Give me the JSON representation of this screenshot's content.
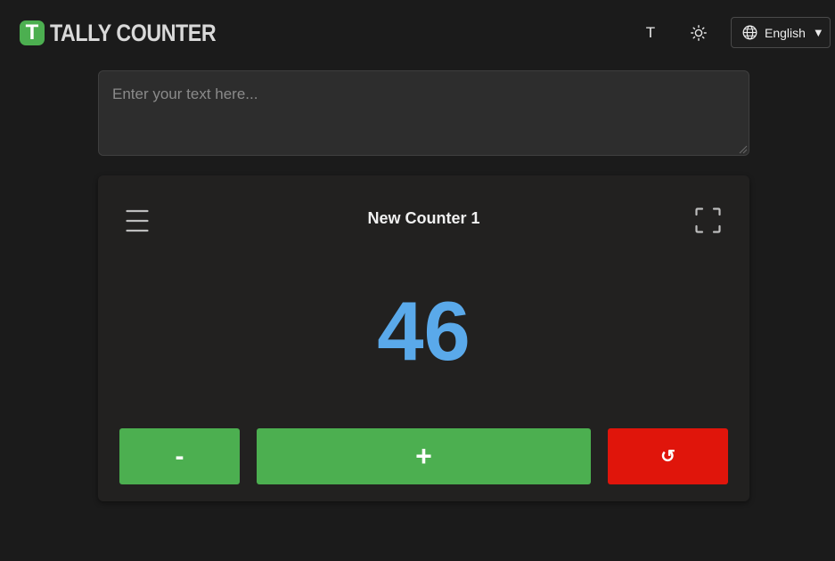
{
  "header": {
    "logo_letter": "T",
    "logo_text": "TALLY COUNTER",
    "font_toggle_label": "T",
    "language": {
      "selected": "English",
      "caret": "▼"
    }
  },
  "input": {
    "value": "",
    "placeholder": "Enter your text here..."
  },
  "counter": {
    "name": "New Counter 1",
    "value": "46",
    "decrement_label": "-",
    "increment_label": "+",
    "reset_label": "↺"
  },
  "colors": {
    "background": "#1b1b1b",
    "accent_green": "#4caf50",
    "reset_red": "#e0150b",
    "count_blue": "#5aa9ea"
  },
  "icons": {
    "theme": "sun-icon",
    "language": "globe-icon",
    "menu": "hamburger-menu-icon",
    "fullscreen": "fullscreen-icon",
    "reset": "reset-icon"
  }
}
